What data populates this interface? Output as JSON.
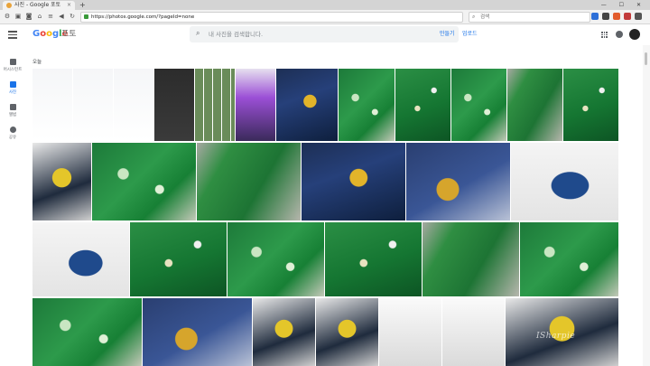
{
  "browser": {
    "tab_title": "사진 - Google 포토",
    "new_tab": "+",
    "window_controls": "— ☐ ✕",
    "url": "https://photos.google.com/?pageId=none",
    "search_placeholder": "검색",
    "close": "×"
  },
  "app": {
    "logo_letters": [
      "G",
      "o",
      "o",
      "g",
      "l",
      "e"
    ],
    "product": "포토",
    "search_placeholder": "내 사진을 검색합니다.",
    "create_link": "만들기",
    "upload_link": "업로드"
  },
  "sidebar": {
    "items": [
      {
        "label": "어시스턴트",
        "active": false
      },
      {
        "label": "사진",
        "active": true
      },
      {
        "label": "앨범",
        "active": false
      },
      {
        "label": "공유",
        "active": false
      }
    ]
  },
  "main": {
    "date_label": "오늘"
  },
  "watermark": "ISharpie",
  "colors": {
    "accent": "#1a73e8",
    "google_blue": "#4285f4",
    "google_red": "#ea4335",
    "google_yellow": "#fbbc05",
    "google_green": "#34a853"
  },
  "icons": {
    "menu": "hamburger-icon",
    "search": "search-icon",
    "apps": "apps-grid-icon",
    "notifications": "bell-icon",
    "account": "avatar"
  }
}
